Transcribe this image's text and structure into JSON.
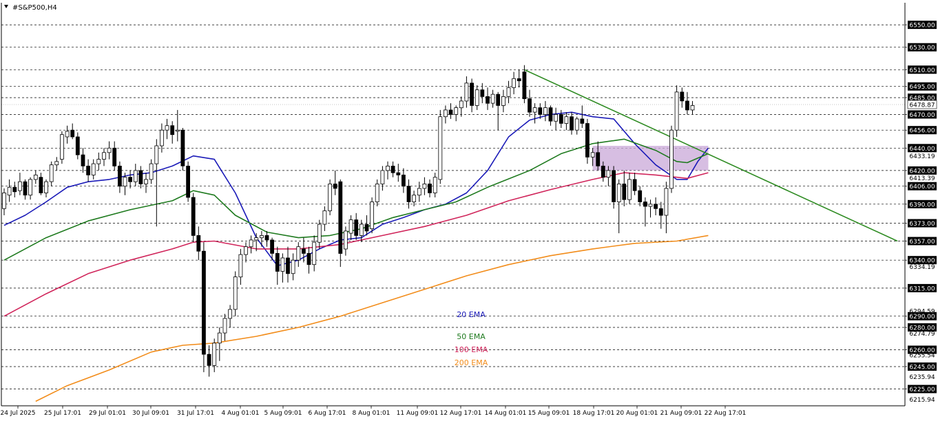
{
  "header": {
    "symbol_label": "#S&P500,H4"
  },
  "colors": {
    "background": "#ffffff",
    "grid": "#000000",
    "candle": "#000000",
    "ema20": "#1a1ab8",
    "ema50": "#1e7a1e",
    "ema100": "#d0245a",
    "ema200": "#f28c1a",
    "trendline": "#2e8b22",
    "zone_fill": "#c9a8d8",
    "price_badge": "#000000"
  },
  "chart_data": {
    "type": "candlestick",
    "title": "#S&P500,H4",
    "ylim": [
      6210,
      6570
    ],
    "grid": "horizontal dashed",
    "y_gridlines": [
      6550,
      6530,
      6510,
      6495,
      6485,
      6470,
      6456,
      6440,
      6420,
      6406,
      6390,
      6373,
      6357,
      6340,
      6315,
      6290,
      6280,
      6260,
      6245,
      6225
    ],
    "y_badges": [
      6550,
      6530,
      6510,
      6495,
      6485,
      6470,
      6456,
      6440,
      6420,
      6406,
      6390,
      6373,
      6357,
      6340,
      6315,
      6290,
      6280,
      6260,
      6245,
      6225
    ],
    "y_plain_labels": [
      "6433.19",
      "6413.39",
      "6334.19",
      "6294.59",
      "6274.79",
      "6255.54",
      "6235.94",
      "6215.94"
    ],
    "current_price": "6478.87",
    "x_labels": [
      "24 Jul 2025",
      "25 Jul 17:01",
      "29 Jul 01:01",
      "30 Jul 09:01",
      "31 Jul 17:01",
      "4 Aug 01:01",
      "5 Aug 09:01",
      "6 Aug 17:01",
      "8 Aug 01:01",
      "11 Aug 09:01",
      "12 Aug 17:01",
      "14 Aug 01:01",
      "15 Aug 09:01",
      "18 Aug 17:01",
      "20 Aug 01:01",
      "21 Aug 09:01",
      "22 Aug 17:01"
    ],
    "candles_ohlc": [
      [
        6386,
        6404,
        6380,
        6400
      ],
      [
        6398,
        6412,
        6392,
        6405
      ],
      [
        6405,
        6410,
        6396,
        6401
      ],
      [
        6402,
        6418,
        6398,
        6410
      ],
      [
        6410,
        6412,
        6394,
        6398
      ],
      [
        6398,
        6414,
        6394,
        6412
      ],
      [
        6412,
        6420,
        6408,
        6416
      ],
      [
        6414,
        6418,
        6398,
        6400
      ],
      [
        6400,
        6412,
        6396,
        6410
      ],
      [
        6410,
        6428,
        6406,
        6425
      ],
      [
        6425,
        6432,
        6420,
        6428
      ],
      [
        6430,
        6455,
        6426,
        6452
      ],
      [
        6450,
        6460,
        6444,
        6455
      ],
      [
        6456,
        6462,
        6448,
        6450
      ],
      [
        6450,
        6454,
        6430,
        6434
      ],
      [
        6434,
        6440,
        6418,
        6424
      ],
      [
        6424,
        6430,
        6410,
        6416
      ],
      [
        6416,
        6430,
        6412,
        6426
      ],
      [
        6426,
        6436,
        6420,
        6430
      ],
      [
        6430,
        6440,
        6424,
        6436
      ],
      [
        6436,
        6446,
        6430,
        6440
      ],
      [
        6440,
        6446,
        6420,
        6424
      ],
      [
        6424,
        6428,
        6400,
        6406
      ],
      [
        6406,
        6418,
        6398,
        6414
      ],
      [
        6414,
        6420,
        6404,
        6410
      ],
      [
        6410,
        6426,
        6406,
        6420
      ],
      [
        6420,
        6424,
        6404,
        6408
      ],
      [
        6408,
        6418,
        6400,
        6412
      ],
      [
        6412,
        6430,
        6408,
        6426
      ],
      [
        6426,
        6448,
        6370,
        6442
      ],
      [
        6442,
        6462,
        6436,
        6456
      ],
      [
        6456,
        6466,
        6448,
        6460
      ],
      [
        6460,
        6464,
        6444,
        6452
      ],
      [
        6455,
        6474,
        6446,
        6456
      ],
      [
        6456,
        6458,
        6420,
        6424
      ],
      [
        6424,
        6428,
        6392,
        6396
      ],
      [
        6396,
        6400,
        6356,
        6362
      ],
      [
        6362,
        6370,
        6340,
        6348
      ],
      [
        6348,
        6356,
        6240,
        6256
      ],
      [
        6256,
        6264,
        6236,
        6246
      ],
      [
        6246,
        6270,
        6240,
        6266
      ],
      [
        6266,
        6280,
        6250,
        6275
      ],
      [
        6275,
        6292,
        6268,
        6288
      ],
      [
        6288,
        6300,
        6280,
        6296
      ],
      [
        6296,
        6330,
        6290,
        6325
      ],
      [
        6325,
        6350,
        6318,
        6345
      ],
      [
        6345,
        6356,
        6338,
        6352
      ],
      [
        6352,
        6362,
        6346,
        6358
      ],
      [
        6358,
        6364,
        6348,
        6360
      ],
      [
        6360,
        6366,
        6352,
        6362
      ],
      [
        6362,
        6366,
        6352,
        6358
      ],
      [
        6358,
        6360,
        6340,
        6346
      ],
      [
        6346,
        6352,
        6318,
        6330
      ],
      [
        6330,
        6346,
        6320,
        6342
      ],
      [
        6342,
        6352,
        6320,
        6328
      ],
      [
        6328,
        6346,
        6322,
        6340
      ],
      [
        6340,
        6356,
        6334,
        6352
      ],
      [
        6350,
        6360,
        6338,
        6346
      ],
      [
        6346,
        6352,
        6328,
        6336
      ],
      [
        6336,
        6362,
        6330,
        6356
      ],
      [
        6356,
        6376,
        6350,
        6372
      ],
      [
        6372,
        6388,
        6366,
        6384
      ],
      [
        6384,
        6412,
        6380,
        6408
      ],
      [
        6408,
        6420,
        6398,
        6404
      ],
      [
        6410,
        6412,
        6334,
        6346
      ],
      [
        6350,
        6370,
        6344,
        6366
      ],
      [
        6364,
        6380,
        6358,
        6376
      ],
      [
        6376,
        6382,
        6358,
        6362
      ],
      [
        6362,
        6376,
        6356,
        6372
      ],
      [
        6372,
        6380,
        6362,
        6366
      ],
      [
        6368,
        6396,
        6364,
        6392
      ],
      [
        6392,
        6412,
        6388,
        6408
      ],
      [
        6408,
        6424,
        6402,
        6420
      ],
      [
        6420,
        6428,
        6412,
        6424
      ],
      [
        6424,
        6428,
        6414,
        6418
      ],
      [
        6418,
        6426,
        6410,
        6416
      ],
      [
        6416,
        6422,
        6400,
        6406
      ],
      [
        6406,
        6412,
        6386,
        6392
      ],
      [
        6392,
        6402,
        6388,
        6398
      ],
      [
        6398,
        6410,
        6392,
        6404
      ],
      [
        6404,
        6414,
        6398,
        6408
      ],
      [
        6408,
        6412,
        6396,
        6400
      ],
      [
        6400,
        6418,
        6396,
        6414
      ],
      [
        6412,
        6474,
        6408,
        6468
      ],
      [
        6468,
        6478,
        6462,
        6474
      ],
      [
        6474,
        6480,
        6466,
        6470
      ],
      [
        6470,
        6478,
        6464,
        6476
      ],
      [
        6476,
        6486,
        6468,
        6482
      ],
      [
        6482,
        6504,
        6476,
        6498
      ],
      [
        6498,
        6502,
        6472,
        6478
      ],
      [
        6478,
        6496,
        6474,
        6492
      ],
      [
        6492,
        6498,
        6480,
        6486
      ],
      [
        6486,
        6494,
        6474,
        6480
      ],
      [
        6480,
        6492,
        6476,
        6488
      ],
      [
        6488,
        6490,
        6456,
        6478
      ],
      [
        6478,
        6492,
        6472,
        6486
      ],
      [
        6486,
        6500,
        6480,
        6494
      ],
      [
        6494,
        6508,
        6488,
        6502
      ],
      [
        6502,
        6510,
        6494,
        6500
      ],
      [
        6508,
        6514,
        6480,
        6484
      ],
      [
        6484,
        6492,
        6468,
        6472
      ],
      [
        6472,
        6480,
        6462,
        6476
      ],
      [
        6476,
        6480,
        6466,
        6470
      ],
      [
        6470,
        6482,
        6464,
        6476
      ],
      [
        6476,
        6478,
        6460,
        6464
      ],
      [
        6464,
        6476,
        6456,
        6470
      ],
      [
        6470,
        6474,
        6458,
        6462
      ],
      [
        6462,
        6472,
        6456,
        6468
      ],
      [
        6468,
        6472,
        6452,
        6456
      ],
      [
        6456,
        6468,
        6452,
        6466
      ],
      [
        6466,
        6478,
        6458,
        6462
      ],
      [
        6462,
        6466,
        6426,
        6432
      ],
      [
        6432,
        6440,
        6424,
        6436
      ],
      [
        6436,
        6446,
        6420,
        6424
      ],
      [
        6424,
        6428,
        6410,
        6414
      ],
      [
        6414,
        6424,
        6406,
        6420
      ],
      [
        6420,
        6424,
        6386,
        6392
      ],
      [
        6392,
        6412,
        6364,
        6408
      ],
      [
        6408,
        6420,
        6388,
        6394
      ],
      [
        6394,
        6418,
        6390,
        6412
      ],
      [
        6412,
        6418,
        6398,
        6402
      ],
      [
        6402,
        6406,
        6388,
        6392
      ],
      [
        6392,
        6396,
        6370,
        6388
      ],
      [
        6388,
        6394,
        6378,
        6390
      ],
      [
        6390,
        6396,
        6380,
        6386
      ],
      [
        6386,
        6392,
        6368,
        6380
      ],
      [
        6380,
        6410,
        6364,
        6404
      ],
      [
        6404,
        6460,
        6400,
        6456
      ],
      [
        6456,
        6496,
        6450,
        6490
      ],
      [
        6490,
        6494,
        6476,
        6482
      ],
      [
        6482,
        6490,
        6470,
        6474
      ],
      [
        6474,
        6482,
        6470,
        6478
      ]
    ],
    "series": [
      {
        "name": "20 EMA",
        "color": "#1a1ab8",
        "values": [
          [
            0,
            6371
          ],
          [
            4,
            6380
          ],
          [
            8,
            6392
          ],
          [
            12,
            6405
          ],
          [
            16,
            6410
          ],
          [
            20,
            6412
          ],
          [
            24,
            6416
          ],
          [
            28,
            6418
          ],
          [
            32,
            6424
          ],
          [
            36,
            6433
          ],
          [
            40,
            6430
          ],
          [
            44,
            6400
          ],
          [
            48,
            6360
          ],
          [
            52,
            6335
          ],
          [
            56,
            6340
          ],
          [
            60,
            6350
          ],
          [
            64,
            6358
          ],
          [
            68,
            6360
          ],
          [
            72,
            6372
          ],
          [
            76,
            6378
          ],
          [
            80,
            6385
          ],
          [
            84,
            6390
          ],
          [
            88,
            6400
          ],
          [
            92,
            6420
          ],
          [
            96,
            6450
          ],
          [
            100,
            6465
          ],
          [
            104,
            6470
          ],
          [
            108,
            6472
          ],
          [
            112,
            6468
          ],
          [
            116,
            6466
          ],
          [
            120,
            6444
          ],
          [
            124,
            6425
          ],
          [
            128,
            6412
          ],
          [
            130,
            6412
          ],
          [
            132,
            6428
          ],
          [
            134,
            6440
          ]
        ]
      },
      {
        "name": "50 EMA",
        "color": "#1e7a1e",
        "values": [
          [
            0,
            6340
          ],
          [
            8,
            6360
          ],
          [
            16,
            6375
          ],
          [
            24,
            6385
          ],
          [
            32,
            6393
          ],
          [
            36,
            6402
          ],
          [
            40,
            6398
          ],
          [
            44,
            6380
          ],
          [
            50,
            6365
          ],
          [
            56,
            6360
          ],
          [
            62,
            6362
          ],
          [
            68,
            6368
          ],
          [
            74,
            6378
          ],
          [
            80,
            6385
          ],
          [
            86,
            6392
          ],
          [
            92,
            6405
          ],
          [
            100,
            6420
          ],
          [
            106,
            6435
          ],
          [
            112,
            6444
          ],
          [
            118,
            6448
          ],
          [
            124,
            6438
          ],
          [
            128,
            6428
          ],
          [
            130,
            6427
          ],
          [
            134,
            6435
          ]
        ]
      },
      {
        "name": "100 EMA",
        "color": "#d0245a",
        "values": [
          [
            0,
            6290
          ],
          [
            8,
            6310
          ],
          [
            16,
            6328
          ],
          [
            24,
            6340
          ],
          [
            32,
            6350
          ],
          [
            36,
            6356
          ],
          [
            40,
            6357
          ],
          [
            48,
            6350
          ],
          [
            56,
            6350
          ],
          [
            64,
            6354
          ],
          [
            72,
            6362
          ],
          [
            80,
            6370
          ],
          [
            88,
            6380
          ],
          [
            96,
            6393
          ],
          [
            104,
            6403
          ],
          [
            112,
            6412
          ],
          [
            118,
            6418
          ],
          [
            124,
            6416
          ],
          [
            130,
            6413
          ],
          [
            134,
            6418
          ]
        ]
      },
      {
        "name": "200 EMA",
        "color": "#f28c1a",
        "values": [
          [
            6,
            6214
          ],
          [
            12,
            6228
          ],
          [
            20,
            6242
          ],
          [
            28,
            6258
          ],
          [
            34,
            6264
          ],
          [
            40,
            6266
          ],
          [
            48,
            6272
          ],
          [
            56,
            6280
          ],
          [
            64,
            6290
          ],
          [
            72,
            6302
          ],
          [
            80,
            6314
          ],
          [
            88,
            6326
          ],
          [
            96,
            6336
          ],
          [
            104,
            6344
          ],
          [
            112,
            6350
          ],
          [
            120,
            6355
          ],
          [
            128,
            6357
          ],
          [
            134,
            6362
          ]
        ]
      }
    ],
    "legend_labels": [
      "20 EMA",
      "50 EMA",
      "100 EMA",
      "200 EMA"
    ],
    "trendline": {
      "start": [
        99,
        6510
      ],
      "end": [
        170,
        6357
      ]
    },
    "zone": {
      "x_from": 112,
      "x_to": 134,
      "y_from": 6420,
      "y_to": 6442
    }
  }
}
